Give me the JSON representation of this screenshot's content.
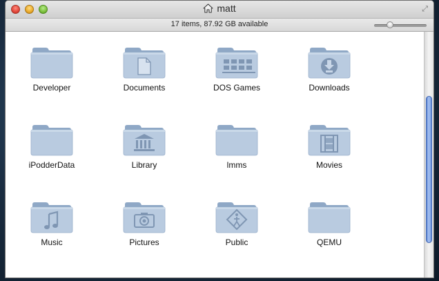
{
  "window": {
    "title": "matt",
    "title_icon": "home-icon",
    "status_text": "17 items, 87.92 GB available",
    "zoom_slider_fraction": 0.3,
    "scroll": {
      "visible_fraction": 0.6,
      "offset_fraction": 0.26
    }
  },
  "colors": {
    "folder_light": "#b9cbe0",
    "folder_dark": "#8fa8c6",
    "emblem": "#7f96b3",
    "scroll_thumb": "#6b92dd"
  },
  "items": [
    {
      "label": "Developer",
      "emblem": "none"
    },
    {
      "label": "Documents",
      "emblem": "document"
    },
    {
      "label": "DOS Games",
      "emblem": "apps"
    },
    {
      "label": "Downloads",
      "emblem": "download"
    },
    {
      "label": "iPodderData",
      "emblem": "none"
    },
    {
      "label": "Library",
      "emblem": "library"
    },
    {
      "label": "lmms",
      "emblem": "none"
    },
    {
      "label": "Movies",
      "emblem": "film"
    },
    {
      "label": "Music",
      "emblem": "music"
    },
    {
      "label": "Pictures",
      "emblem": "camera"
    },
    {
      "label": "Public",
      "emblem": "public"
    },
    {
      "label": "QEMU",
      "emblem": "none"
    }
  ]
}
